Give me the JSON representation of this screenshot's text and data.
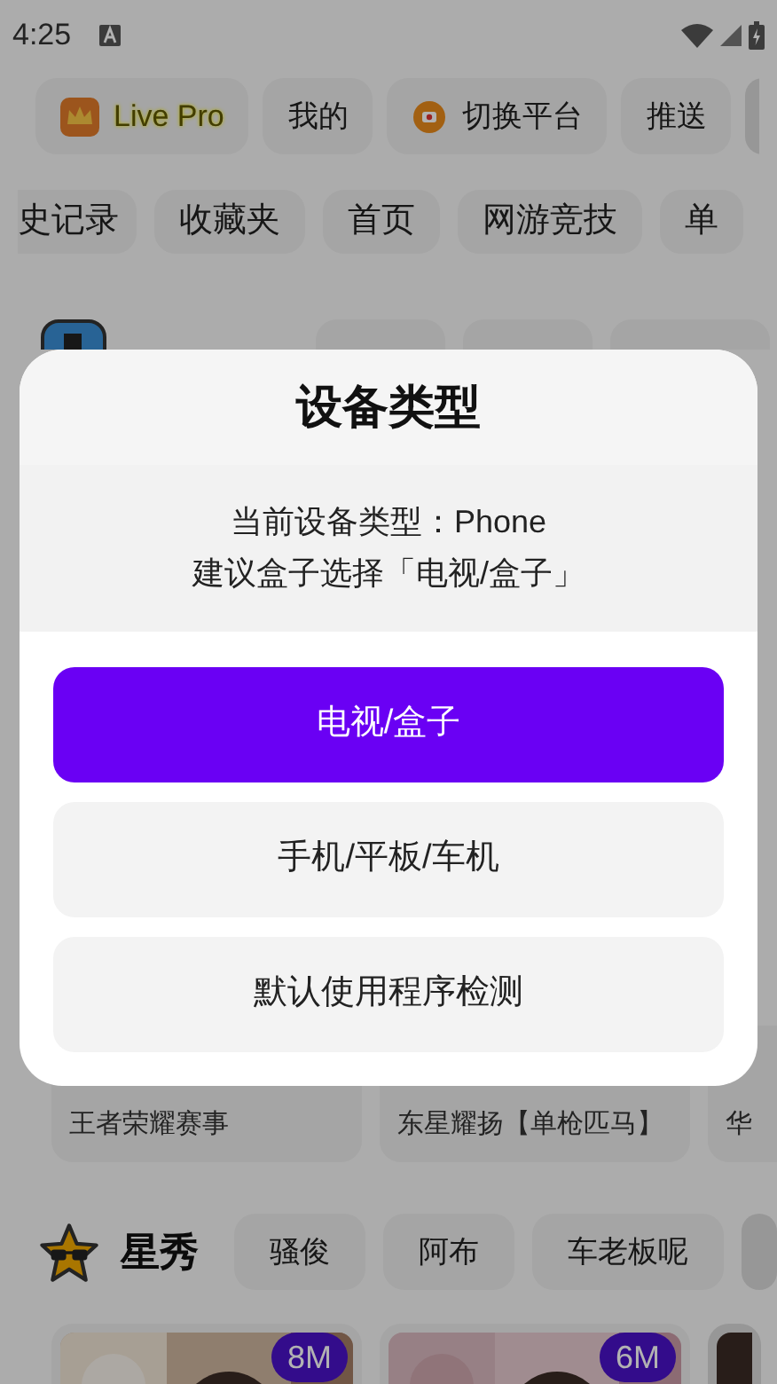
{
  "status_bar": {
    "time": "4:25"
  },
  "top_chips": [
    {
      "label": "Live Pro",
      "kind": "brand"
    },
    {
      "label": "我的",
      "kind": "plain"
    },
    {
      "label": "切换平台",
      "kind": "app"
    },
    {
      "label": "推送",
      "kind": "plain"
    }
  ],
  "categories": [
    {
      "label": "史记录"
    },
    {
      "label": "收藏夹"
    },
    {
      "label": "首页"
    },
    {
      "label": "网游竞技"
    },
    {
      "label": "单"
    }
  ],
  "cards": [
    {
      "subtitle": "王者荣耀赛事"
    },
    {
      "subtitle": "东星耀扬【单枪匹马】"
    },
    {
      "subtitle": "华"
    }
  ],
  "star_section": {
    "title": "星秀",
    "tags": [
      "骚俊",
      "阿布",
      "车老板呢"
    ]
  },
  "live_cards": [
    {
      "badge": "8M"
    },
    {
      "badge": "6M"
    }
  ],
  "dialog": {
    "title": "设备类型",
    "message": [
      "当前设备类型：Phone",
      "建议盒子选择「电视/盒子」"
    ],
    "options": [
      {
        "label": "电视/盒子",
        "selected": true
      },
      {
        "label": "手机/平板/车机",
        "selected": false
      },
      {
        "label": "默认使用程序检测",
        "selected": false
      }
    ]
  }
}
